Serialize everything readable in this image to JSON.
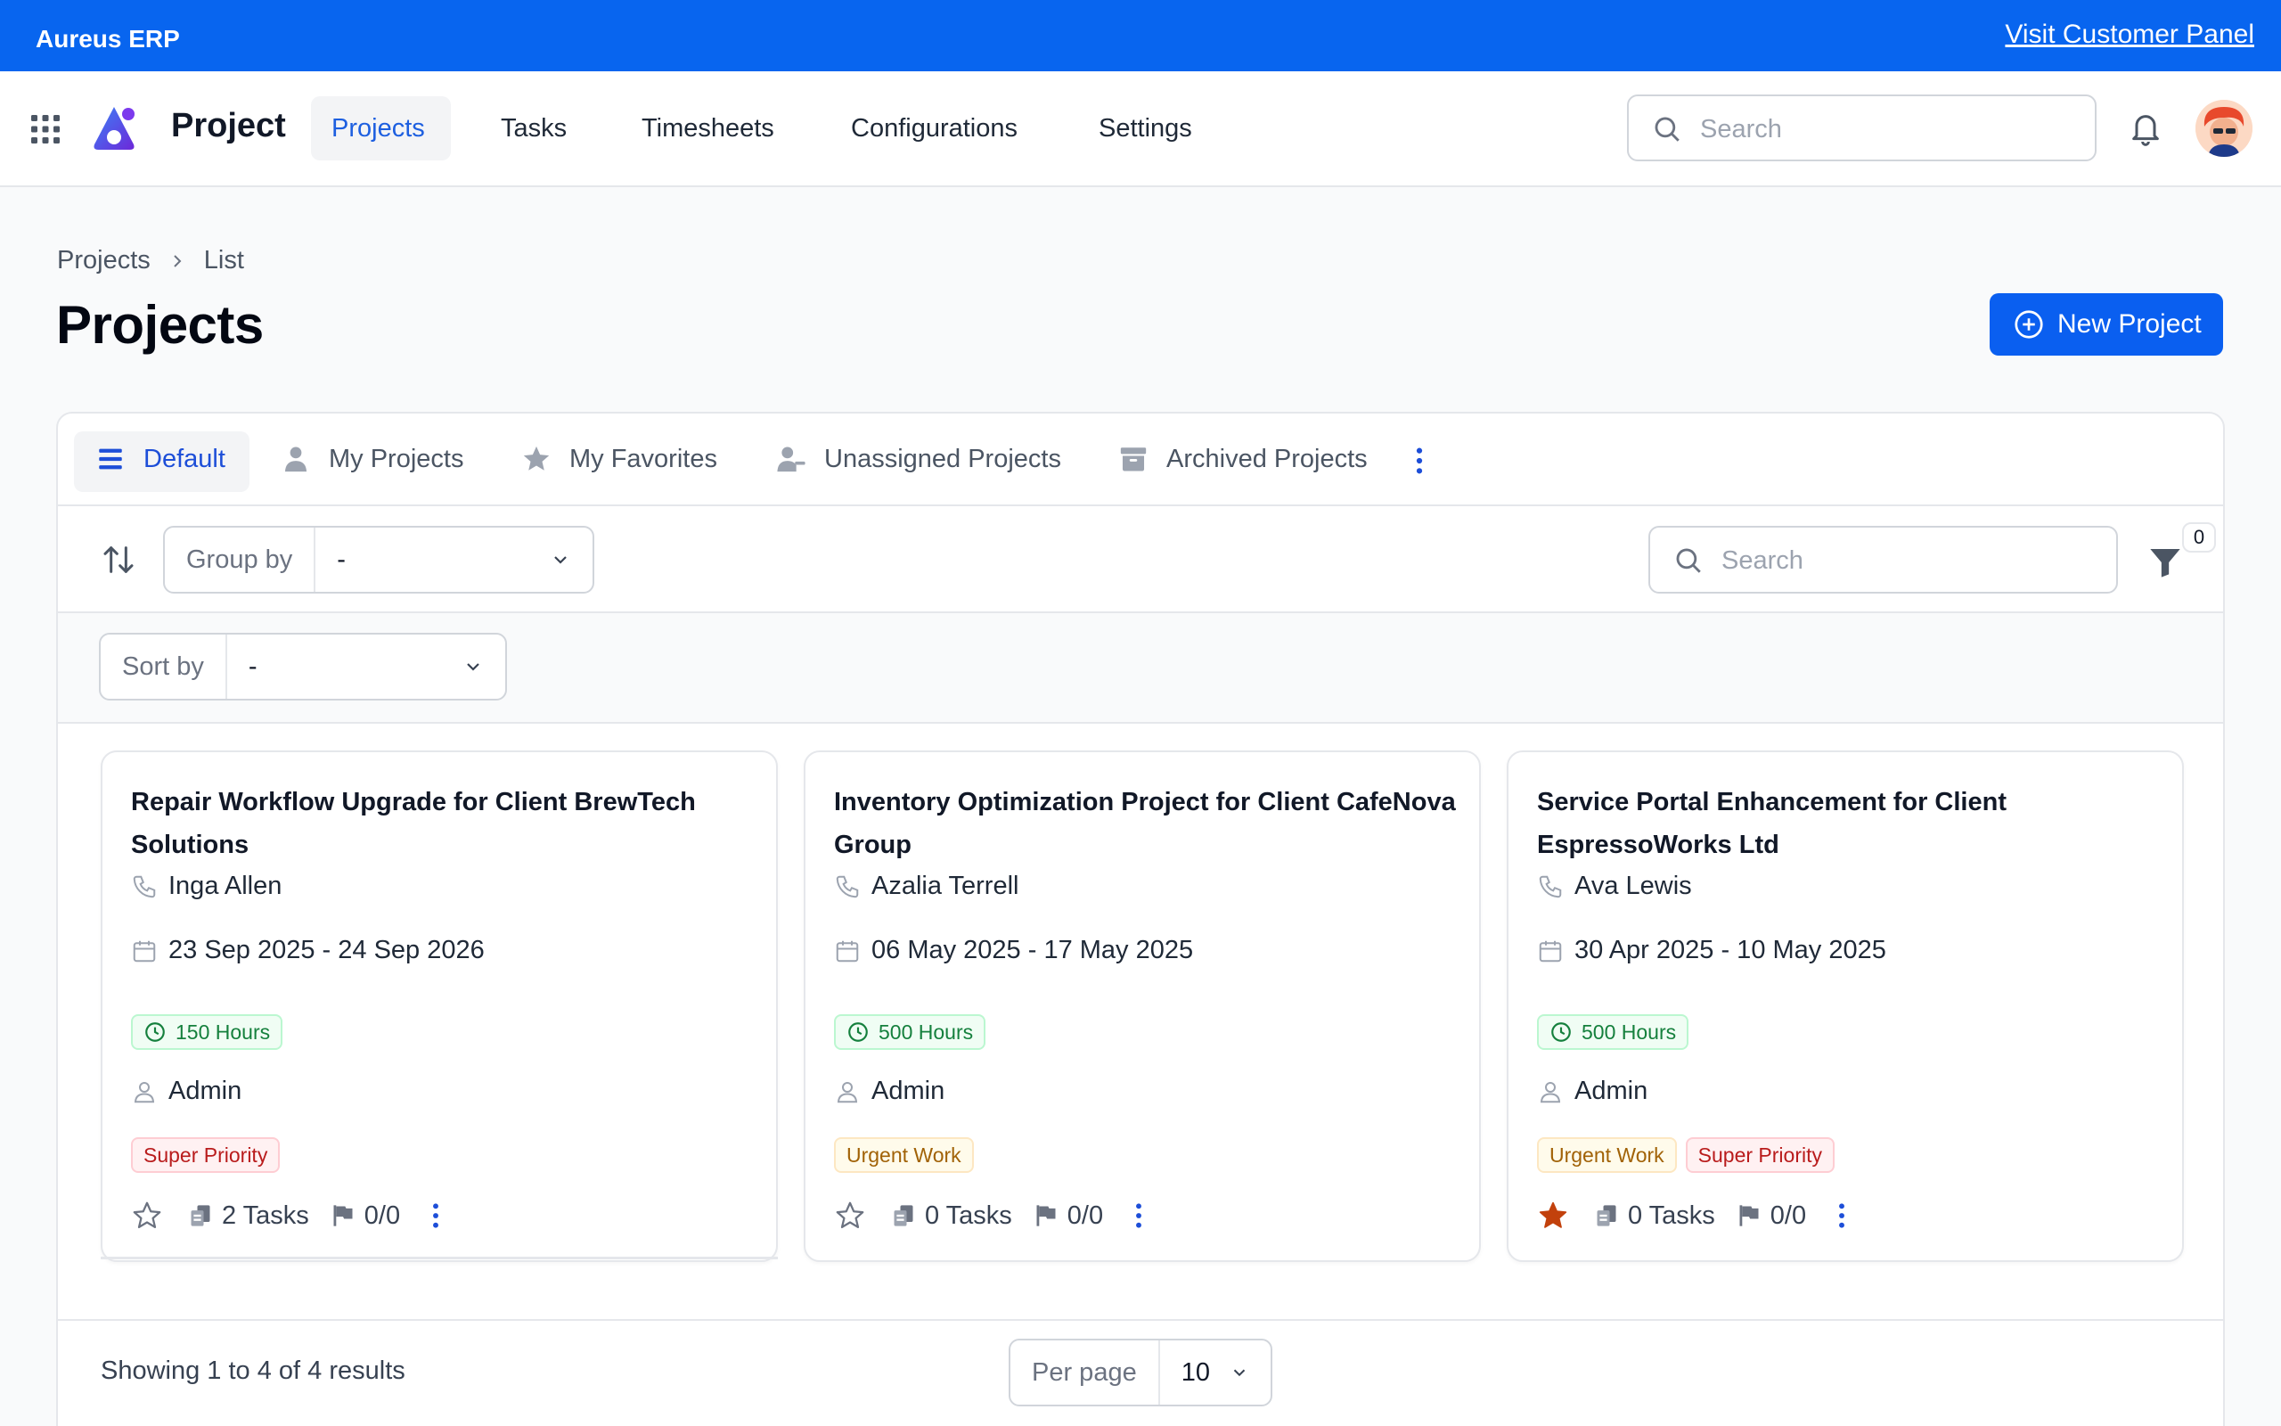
{
  "topbar": {
    "brand": "Aureus ERP",
    "visit_link": "Visit Customer Panel",
    "color": "#0865ef"
  },
  "navbar": {
    "app_title": "Project",
    "items": [
      {
        "label": "Projects",
        "active": true
      },
      {
        "label": "Tasks"
      },
      {
        "label": "Timesheets"
      },
      {
        "label": "Configurations"
      },
      {
        "label": "Settings"
      }
    ],
    "search_placeholder": "Search"
  },
  "breadcrumb": {
    "parent": "Projects",
    "current": "List"
  },
  "page": {
    "title": "Projects",
    "new_button": "New Project"
  },
  "tabs": [
    {
      "label": "Default",
      "icon": "list-icon",
      "active": true
    },
    {
      "label": "My Projects",
      "icon": "user-icon"
    },
    {
      "label": "My Favorites",
      "icon": "star-icon"
    },
    {
      "label": "Unassigned Projects",
      "icon": "user-minus-icon"
    },
    {
      "label": "Archived Projects",
      "icon": "archive-icon"
    }
  ],
  "toolbar": {
    "group_by_label": "Group by",
    "group_by_value": "-",
    "search_placeholder": "Search",
    "filter_count": "0",
    "sort_by_label": "Sort by",
    "sort_by_value": "-"
  },
  "cards": [
    {
      "title": "Repair Workflow Upgrade for Client BrewTech Solutions",
      "contact": "Inga Allen",
      "dates": "23 Sep 2025 - 24 Sep 2026",
      "hours": "150 Hours",
      "manager": "Admin",
      "tags": [
        {
          "label": "Super Priority",
          "kind": "super"
        }
      ],
      "favorite": false,
      "tasks": "2 Tasks",
      "milestones": "0/0"
    },
    {
      "title": "Inventory Optimization Project for Client CafeNova Group",
      "contact": "Azalia Terrell",
      "dates": "06 May 2025 - 17 May 2025",
      "hours": "500 Hours",
      "manager": "Admin",
      "tags": [
        {
          "label": "Urgent Work",
          "kind": "urgent"
        }
      ],
      "favorite": false,
      "tasks": "0 Tasks",
      "milestones": "0/0"
    },
    {
      "title": "Service Portal Enhancement for Client EspressoWorks Ltd",
      "contact": "Ava Lewis",
      "dates": "30 Apr 2025 - 10 May 2025",
      "hours": "500 Hours",
      "manager": "Admin",
      "tags": [
        {
          "label": "Urgent Work",
          "kind": "urgent"
        },
        {
          "label": "Super Priority",
          "kind": "super"
        }
      ],
      "favorite": true,
      "tasks": "0 Tasks",
      "milestones": "0/0"
    }
  ],
  "footer": {
    "results": "Showing 1 to 4 of 4 results",
    "per_page_label": "Per page",
    "per_page_value": "10"
  },
  "colors": {
    "primary": "#0a5ff0",
    "favorite": "#c2410c",
    "hours_green": "#15803d"
  }
}
